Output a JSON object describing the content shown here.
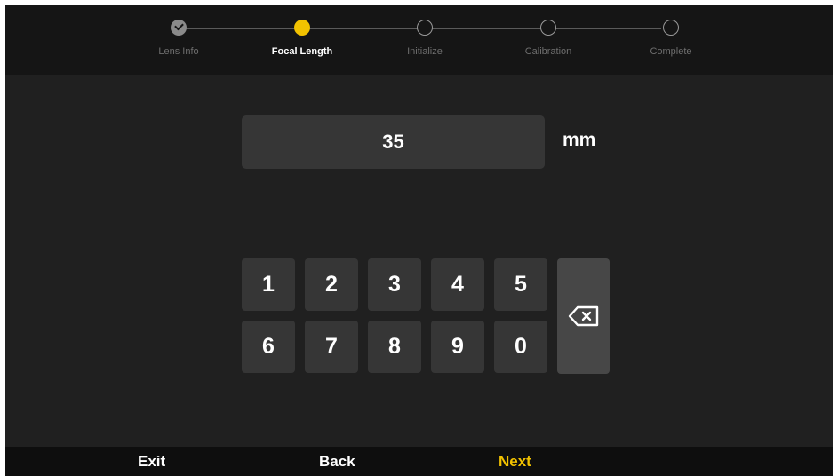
{
  "stepper": {
    "steps": [
      {
        "label": "Lens Info",
        "state": "done"
      },
      {
        "label": "Focal Length",
        "state": "active"
      },
      {
        "label": "Initialize",
        "state": "todo"
      },
      {
        "label": "Calibration",
        "state": "todo"
      },
      {
        "label": "Complete",
        "state": "todo"
      }
    ]
  },
  "focal_length": {
    "value": "35",
    "unit": "mm"
  },
  "keypad": {
    "keys": [
      "1",
      "2",
      "3",
      "4",
      "5",
      "6",
      "7",
      "8",
      "9",
      "0"
    ],
    "backspace_icon": "backspace-icon"
  },
  "footer": {
    "exit_label": "Exit",
    "back_label": "Back",
    "next_label": "Next"
  },
  "colors": {
    "accent": "#f2c200",
    "background": "#202020",
    "header": "#151515",
    "key": "#363636"
  }
}
